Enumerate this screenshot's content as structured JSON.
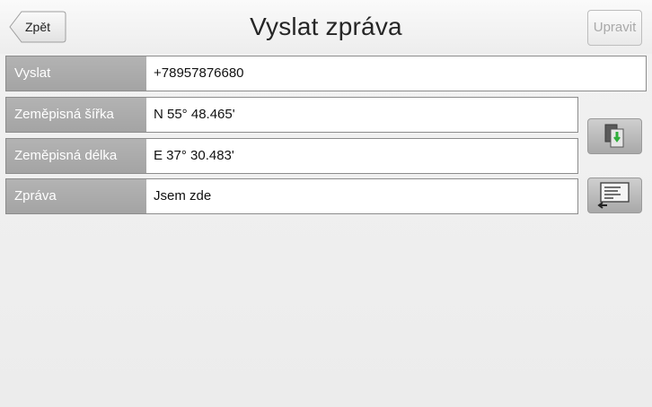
{
  "header": {
    "title": "Vyslat zpráva",
    "back_label": "Zpět",
    "edit_label": "Upravit"
  },
  "form": {
    "rows": [
      {
        "label": "Vyslat",
        "value": "+78957876680"
      },
      {
        "label": "Zeměpisná šířka",
        "value": "N 55°  48.465'"
      },
      {
        "label": "Zeměpisná délka",
        "value": "E 37°  30.483'"
      },
      {
        "label": "Zpráva",
        "value": "Jsem zde"
      }
    ]
  },
  "side_buttons": {
    "location_icon": "copy-position-icon",
    "template_icon": "insert-message-icon"
  },
  "colors": {
    "label_bg": "#a9a9a9",
    "accent_green": "#2fae3a"
  }
}
